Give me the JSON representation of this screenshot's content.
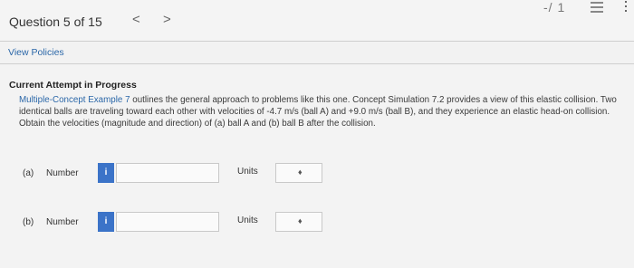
{
  "header": {
    "question_counter": "Question 5 of 15",
    "prev_icon": "chevron-left-icon",
    "next_icon": "chevron-right-icon",
    "prev_glyph": "<",
    "next_glyph": ">",
    "score": "-/ 1",
    "list_icon": "list-icon",
    "more_icon": "more-vertical-icon"
  },
  "policies": {
    "link_label": "View Policies"
  },
  "attempt": {
    "status": "Current Attempt in Progress"
  },
  "problem": {
    "link_text": "Multiple-Concept Example 7",
    "text": " outlines the general approach to problems like this one. Concept Simulation 7.2 provides a view of this elastic collision. Two identical balls are traveling toward each other with velocities of -4.7 m/s (ball A) and +9.0 m/s (ball B), and they experience an elastic head-on collision. Obtain the velocities (magnitude and direction) of (a) ball A and (b) ball B after the collision."
  },
  "answers": [
    {
      "part": "(a)",
      "number_label": "Number",
      "info_glyph": "i",
      "value": "",
      "units_label": "Units",
      "units_value": ""
    },
    {
      "part": "(b)",
      "number_label": "Number",
      "info_glyph": "i",
      "value": "",
      "units_label": "Units",
      "units_value": ""
    }
  ],
  "colors": {
    "link": "#2b67a8",
    "info_button": "#3b73c8",
    "background": "#f3f3f3"
  }
}
